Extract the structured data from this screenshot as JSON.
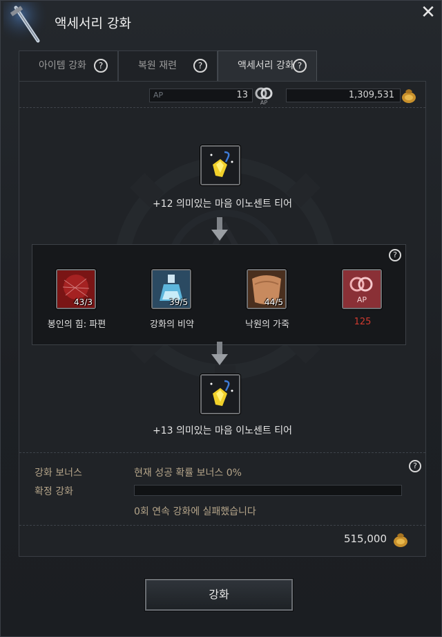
{
  "window": {
    "title": "액세서리 강화",
    "close_glyph": "✕"
  },
  "tabs": [
    {
      "label": "아이템 강화",
      "help": "?"
    },
    {
      "label": "복원 재련",
      "help": "?"
    },
    {
      "label": "액세서리 강화",
      "help": "?",
      "active": true
    }
  ],
  "currency": {
    "ap_label": "AP",
    "ap_value": "13",
    "silver_value": "1,309,531"
  },
  "source_item": {
    "name": "+12 의미있는 마음 이노센트 티어",
    "icon": "yellow-gem-ring-icon"
  },
  "materials": {
    "help": "?",
    "items": [
      {
        "label": "봉인의 힘: 파편",
        "qty": "43/3",
        "icon": "red-fragment-icon"
      },
      {
        "label": "강화의 비약",
        "qty": "39/5",
        "icon": "blue-potion-icon"
      },
      {
        "label": "낙원의 가죽",
        "qty": "44/5",
        "icon": "leather-icon"
      },
      {
        "label": "125",
        "qty": "",
        "icon": "ap-icon",
        "color": "#d03a2f"
      }
    ]
  },
  "result_item": {
    "name": "+13 의미있는 마음 이노센트 티어",
    "icon": "yellow-gem-ring-icon"
  },
  "bonus": {
    "help": "?",
    "bonus_label": "강화 보너스",
    "bonus_text": "현재 성공 확률 보너스 0%",
    "guarantee_label": "확정 강화",
    "guarantee_progress": 0,
    "fail_text": "0회 연속 강화에 실패했습니다"
  },
  "cost": "515,000",
  "enhance_button": "강화",
  "colors": {
    "accent_gold": "#b5a58a",
    "ap_red": "#d03a2f"
  }
}
